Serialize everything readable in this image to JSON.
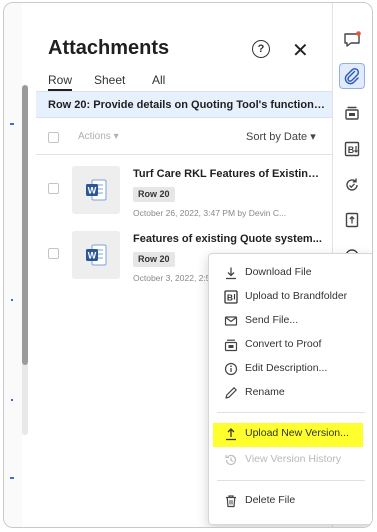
{
  "panel": {
    "title": "Attachments",
    "help_glyph": "?",
    "close_glyph": "✕",
    "tabs": [
      {
        "label": "Row",
        "active": true
      },
      {
        "label": "Sheet",
        "active": false
      },
      {
        "label": "All",
        "active": false
      }
    ],
    "banner": "Row 20: Provide details on Quoting Tool's functionalit...",
    "toolbar": {
      "actions_label": "Actions ▾",
      "sort_label": "Sort by Date ▾"
    },
    "files": [
      {
        "name": "Turf Care RKL Features of Existing ...",
        "badge": "Row 20",
        "meta": "October 26, 2022, 3:47 PM by Devin C...",
        "file_icon": "word-doc-icon"
      },
      {
        "name": "Features of existing Quote system...",
        "badge": "Row 20",
        "meta": "October 3, 2022, 2:5",
        "file_icon": "word-doc-icon"
      }
    ]
  },
  "context_menu": {
    "items": [
      {
        "label": "Download File",
        "icon": "download-icon"
      },
      {
        "label": "Upload to Brandfolder",
        "icon": "brandfolder-icon"
      },
      {
        "label": "Send File...",
        "icon": "mail-icon"
      },
      {
        "label": "Convert to Proof",
        "icon": "proof-icon"
      },
      {
        "label": "Edit Description...",
        "icon": "info-icon"
      },
      {
        "label": "Rename",
        "icon": "pencil-icon"
      },
      {
        "label": "Upload New Version...",
        "icon": "upload-icon",
        "highlighted": true
      },
      {
        "label": "View Version History",
        "icon": "history-icon",
        "disabled": true
      },
      {
        "label": "Delete File",
        "icon": "trash-icon"
      }
    ]
  },
  "rail": {
    "buttons": [
      "comment-icon",
      "attachment-icon",
      "proof-stack-icon",
      "brandfolder-icon",
      "update-request-icon",
      "publish-icon",
      "more-icon"
    ]
  },
  "colors": {
    "highlight": "#ffff2e",
    "banner_bg": "#e7f0fd",
    "rail_active_bg": "#e2ebfb",
    "notification_dot": "#e8533e",
    "word_blue": "#2b5797"
  }
}
